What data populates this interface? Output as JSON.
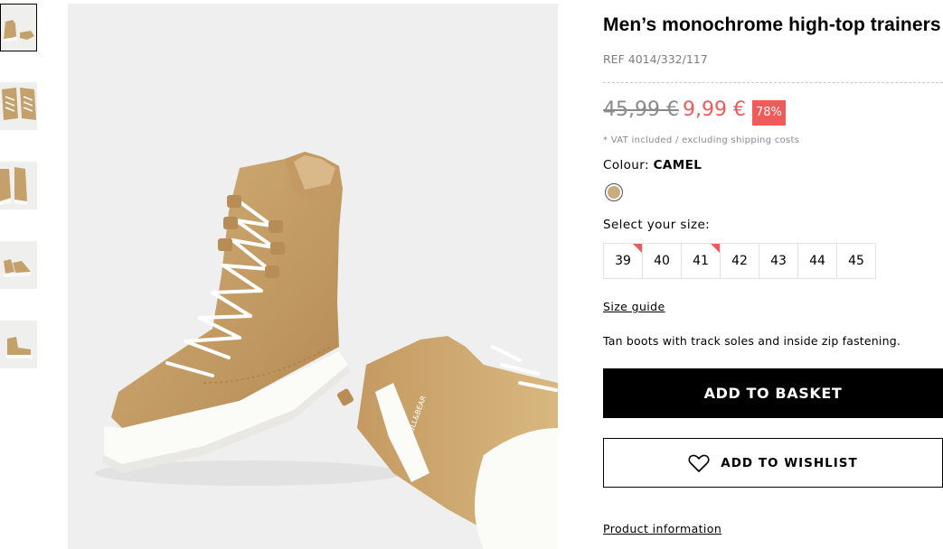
{
  "gallery": {
    "thumbnails": [
      {
        "name": "thumb-1",
        "selected": true
      },
      {
        "name": "thumb-2",
        "selected": false
      },
      {
        "name": "thumb-3",
        "selected": false
      },
      {
        "name": "thumb-4",
        "selected": false
      },
      {
        "name": "thumb-5",
        "selected": false
      }
    ],
    "shoe_text": "PULL&BEAR"
  },
  "product": {
    "title": "Men’s monochrome high-top trainers",
    "ref": "REF 4014/332/117",
    "old_price": "45,99 €",
    "new_price": "9,99 €",
    "discount": "78%",
    "vat_note": "* VAT included / excluding shipping costs",
    "colour_label": "Colour: ",
    "colour_value": "CAMEL",
    "size_label": "Select your size:",
    "sizes": [
      {
        "label": "39",
        "low_stock": true
      },
      {
        "label": "40",
        "low_stock": false
      },
      {
        "label": "41",
        "low_stock": true
      },
      {
        "label": "42",
        "low_stock": false
      },
      {
        "label": "43",
        "low_stock": false
      },
      {
        "label": "44",
        "low_stock": false
      },
      {
        "label": "45",
        "low_stock": false
      }
    ],
    "size_guide": "Size guide",
    "description": "Tan boots with track soles and inside zip fastening.",
    "add_to_basket": "ADD TO BASKET",
    "add_to_wishlist": "ADD TO WISHLIST",
    "product_information": "Product information"
  },
  "colors": {
    "sale": "#ef5a5a",
    "camel": "#c9ad80"
  }
}
